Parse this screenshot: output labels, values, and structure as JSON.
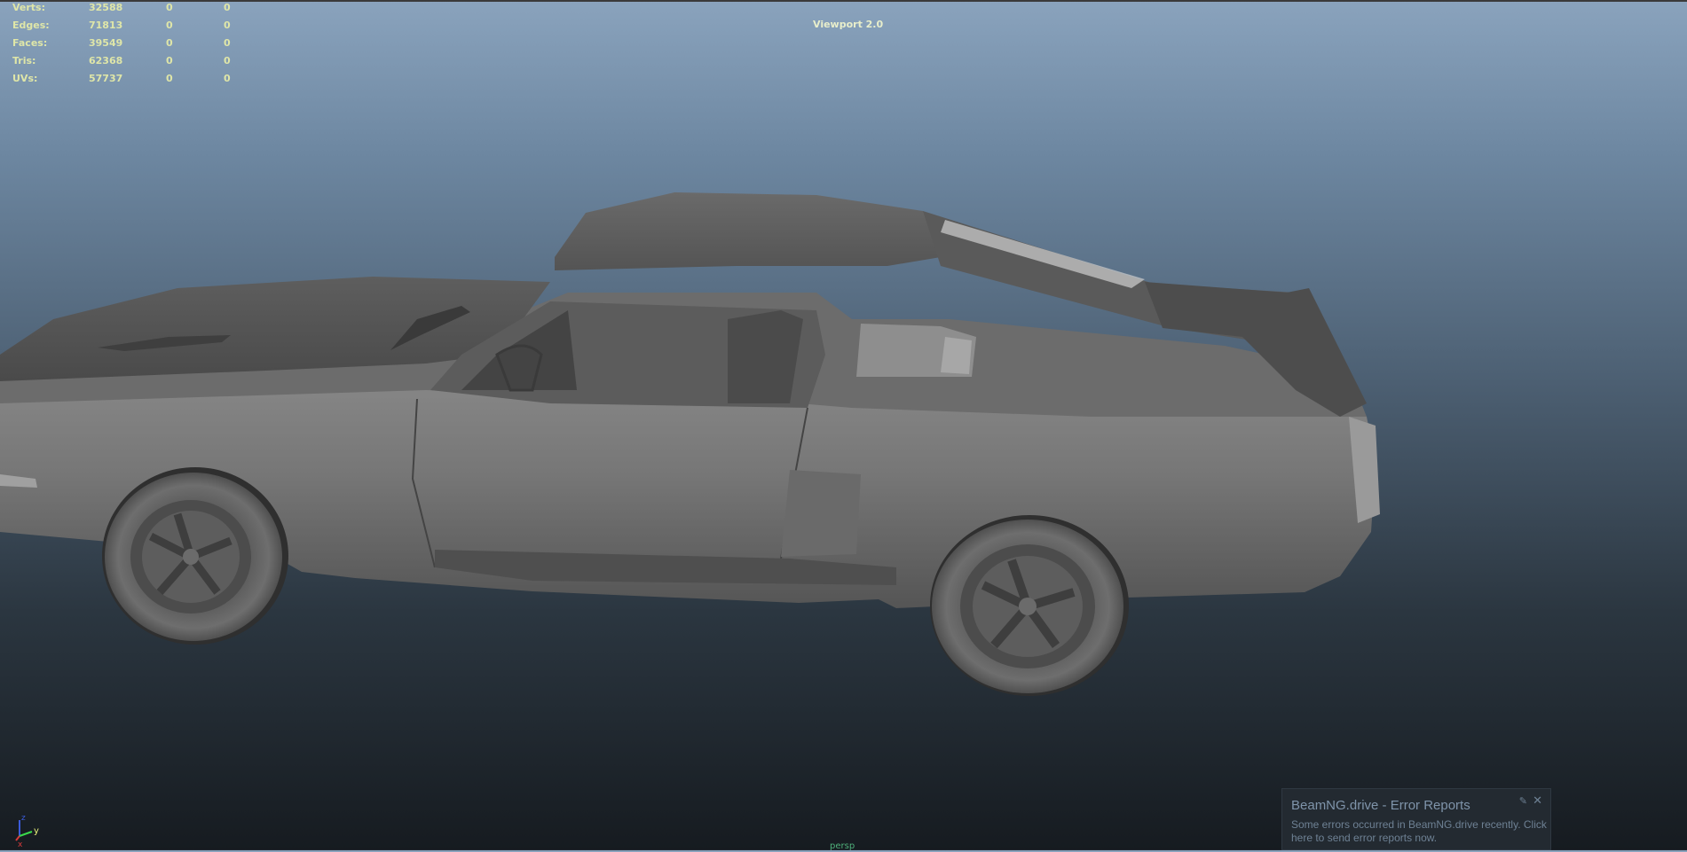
{
  "hud": {
    "rows": [
      {
        "label": "Verts:",
        "v1": "32588",
        "v2": "0",
        "v3": "0"
      },
      {
        "label": "Edges:",
        "v1": "71813",
        "v2": "0",
        "v3": "0"
      },
      {
        "label": "Faces:",
        "v1": "39549",
        "v2": "0",
        "v3": "0"
      },
      {
        "label": "Tris:",
        "v1": "62368",
        "v2": "0",
        "v3": "0"
      },
      {
        "label": "UVs:",
        "v1": "57737",
        "v2": "0",
        "v3": "0"
      }
    ]
  },
  "viewport": {
    "title": "Viewport 2.0",
    "camera": "persp"
  },
  "axis": {
    "y": "y",
    "x": "x",
    "z": "z"
  },
  "notification": {
    "title": "BeamNG.drive - Error Reports",
    "body": "Some errors occurred in BeamNG.drive recently. Click here to send error reports now.",
    "pin_icon": "pin-icon",
    "close_glyph": "✕"
  },
  "colors": {
    "hud_text": "#dfe6a8",
    "bg_top": "#8aa3bd",
    "bg_bottom": "#161b20",
    "car_body": "#7a7a7a"
  }
}
